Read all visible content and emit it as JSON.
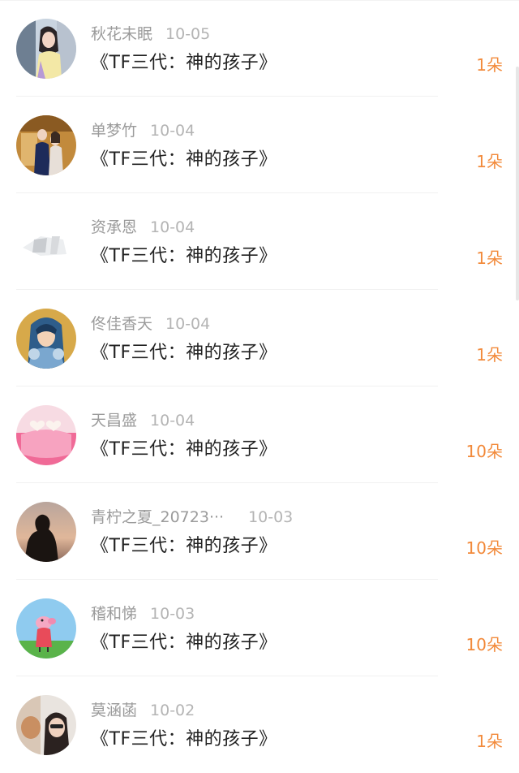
{
  "colors": {
    "name": "#9b9b9b",
    "date": "#b4b4b4",
    "title": "#222222",
    "quantity": "#f28a3b"
  },
  "items": [
    {
      "user": "秋花未眠",
      "date": "10-05",
      "title": "《TF三代：神的孩子》",
      "quantity": "1朵",
      "avatar_icon": "girl-photo-avatar-icon"
    },
    {
      "user": "单梦竹",
      "date": "10-04",
      "title": "《TF三代：神的孩子》",
      "quantity": "1朵",
      "avatar_icon": "couple-photo-avatar-icon"
    },
    {
      "user": "资承恩",
      "date": "10-04",
      "title": "《TF三代：神的孩子》",
      "quantity": "1朵",
      "avatar_icon": "pale-logo-avatar-icon"
    },
    {
      "user": "佟佳香天",
      "date": "10-04",
      "title": "《TF三代：神的孩子》",
      "quantity": "1朵",
      "avatar_icon": "game-character-avatar-icon"
    },
    {
      "user": "天昌盛",
      "date": "10-04",
      "title": "《TF三代：神的孩子》",
      "quantity": "10朵",
      "avatar_icon": "heart-pillow-avatar-icon"
    },
    {
      "user": "青柠之夏_20723···",
      "date": "10-03",
      "title": "《TF三代：神的孩子》",
      "quantity": "10朵",
      "avatar_icon": "sunset-silhouette-avatar-icon"
    },
    {
      "user": "稽和悌",
      "date": "10-03",
      "title": "《TF三代：神的孩子》",
      "quantity": "10朵",
      "avatar_icon": "cartoon-pig-avatar-icon"
    },
    {
      "user": "莫涵菡",
      "date": "10-02",
      "title": "《TF三代：神的孩子》",
      "quantity": "1朵",
      "avatar_icon": "selfie-avatar-icon"
    }
  ]
}
